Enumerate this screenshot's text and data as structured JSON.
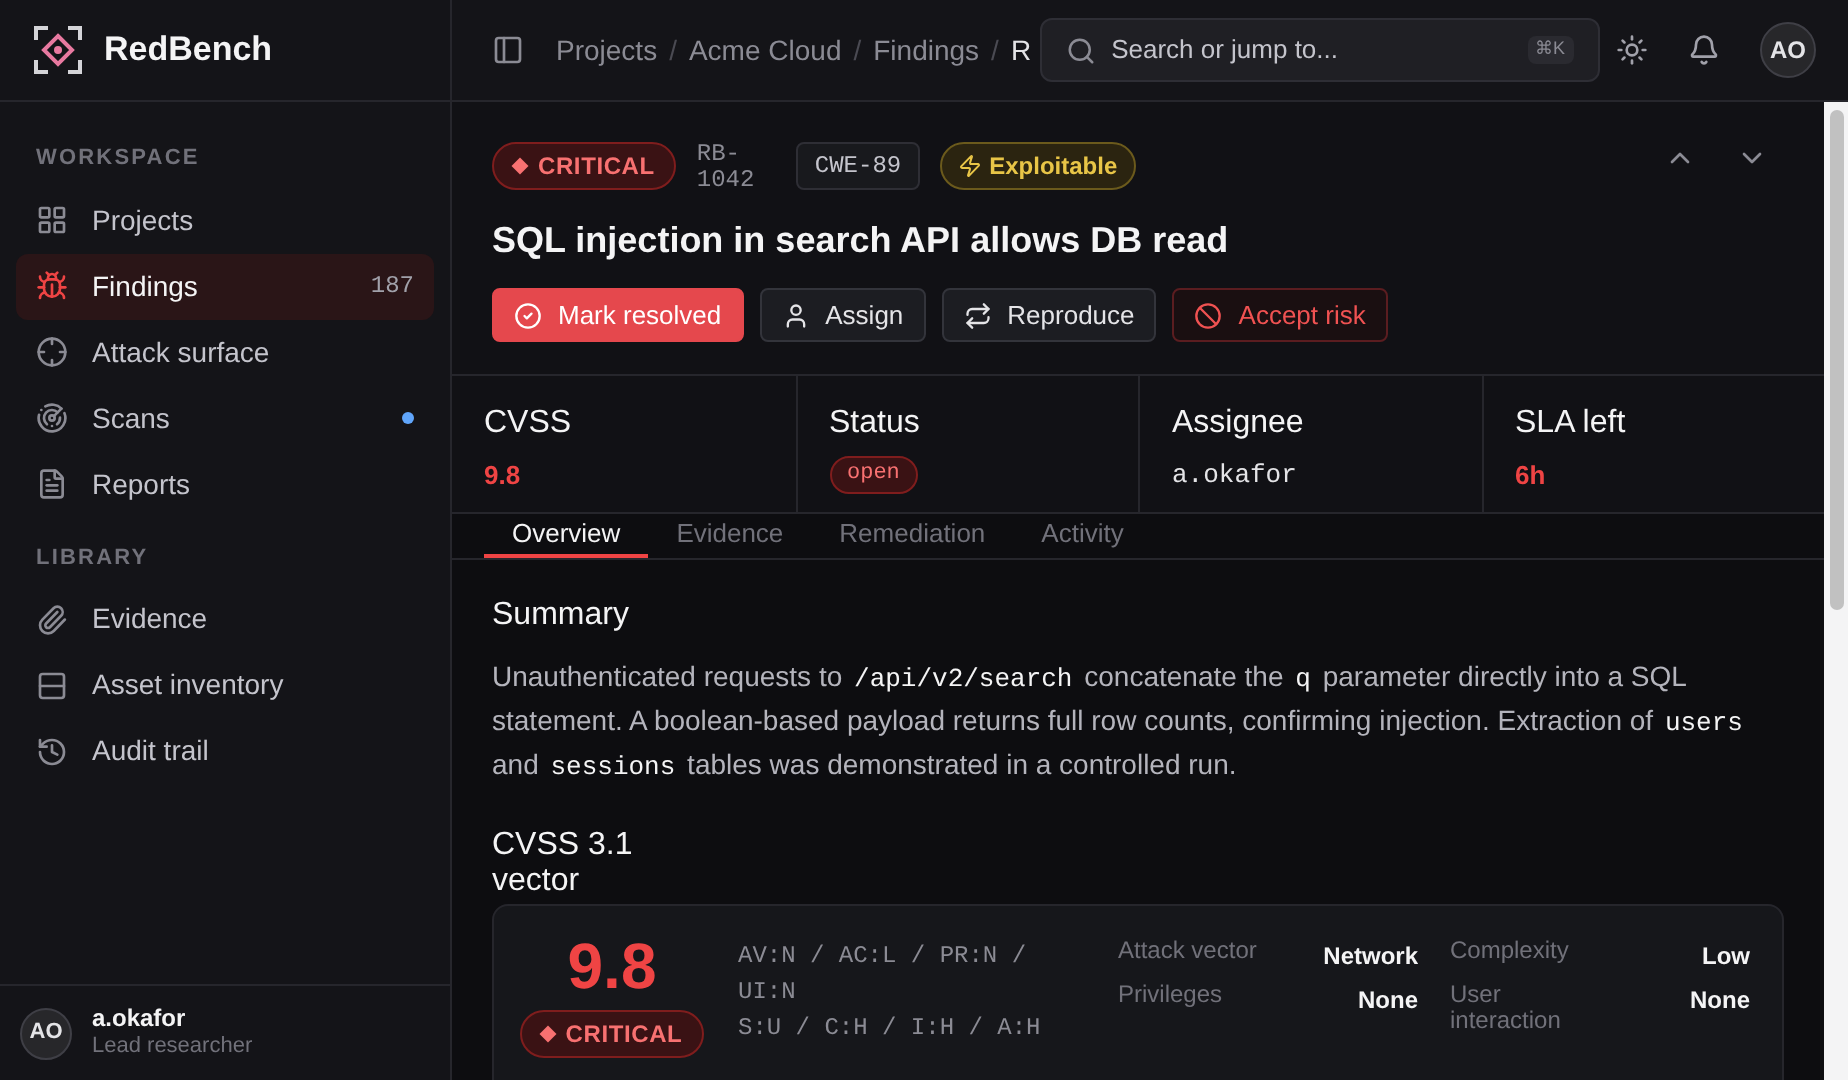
{
  "app": {
    "name": "RedBench"
  },
  "sidebar": {
    "sections": [
      {
        "heading": "WORKSPACE",
        "items": [
          {
            "label": "Projects",
            "selected": false
          },
          {
            "label": "Findings",
            "selected": true,
            "count": "187"
          },
          {
            "label": "Attack surface",
            "selected": false
          },
          {
            "label": "Scans",
            "selected": false,
            "dot": true
          },
          {
            "label": "Reports",
            "selected": false
          }
        ]
      },
      {
        "heading": "LIBRARY",
        "items": [
          {
            "label": "Evidence",
            "selected": false
          },
          {
            "label": "Asset inventory",
            "selected": false
          },
          {
            "label": "Audit trail",
            "selected": false
          }
        ]
      }
    ],
    "user": {
      "initials": "AO",
      "name": "a.okafor",
      "role": "Lead researcher"
    }
  },
  "topbar": {
    "breadcrumb": [
      "Projects",
      "Acme Cloud",
      "Findings",
      "R"
    ],
    "separator": "/",
    "search": {
      "placeholder": "Search or jump to...",
      "shortcut": "⌘K"
    },
    "avatar": "AO"
  },
  "finding": {
    "severity": "CRITICAL",
    "id": "RB-1042",
    "cwe": "CWE-89",
    "exploitable": "Exploitable",
    "title": "SQL injection in search API allows DB read",
    "actions": [
      {
        "label": "Mark resolved",
        "kind": "primary"
      },
      {
        "label": "Assign",
        "kind": "neutral"
      },
      {
        "label": "Reproduce",
        "kind": "neutral"
      },
      {
        "label": "Accept risk",
        "kind": "danger"
      }
    ]
  },
  "stats": [
    {
      "label": "CVSS",
      "value": "9.8",
      "kind": "danger"
    },
    {
      "label": "Status",
      "value": "open",
      "kind": "badge"
    },
    {
      "label": "Assignee",
      "value": "a.okafor",
      "kind": "mono"
    },
    {
      "label": "SLA left",
      "value": "6h",
      "kind": "danger"
    }
  ],
  "tabs": [
    {
      "label": "Overview",
      "selected": true
    },
    {
      "label": "Evidence",
      "selected": false
    },
    {
      "label": "Remediation",
      "selected": false
    },
    {
      "label": "Activity",
      "selected": false
    }
  ],
  "summary": {
    "heading": "Summary",
    "segments": [
      {
        "kind": "text",
        "text": "Unauthenticated requests to "
      },
      {
        "kind": "code",
        "text": "/api/v2/search"
      },
      {
        "kind": "text",
        "text": " concatenate the "
      },
      {
        "kind": "code",
        "text": "q"
      },
      {
        "kind": "text",
        "text": " parameter directly into a SQL statement. A boolean-based payload returns full row counts, confirming injection. Extraction of "
      },
      {
        "kind": "code",
        "text": "users"
      },
      {
        "kind": "text",
        "text": " and "
      },
      {
        "kind": "code",
        "text": "sessions"
      },
      {
        "kind": "text",
        "text": " tables was demonstrated in a controlled run."
      }
    ]
  },
  "cvss": {
    "heading": "CVSS 3.1 vector",
    "score": "9.8",
    "severity": "CRITICAL",
    "vector": [
      "AV:N / AC:L / PR:N / UI:N",
      "S:U / C:H / I:H / A:H"
    ],
    "metrics": [
      {
        "label": "Attack vector",
        "value": "Network"
      },
      {
        "label": "Complexity",
        "value": "Low"
      },
      {
        "label": "Privileges",
        "value": "None"
      },
      {
        "label": "User interaction",
        "value": "None"
      }
    ]
  }
}
